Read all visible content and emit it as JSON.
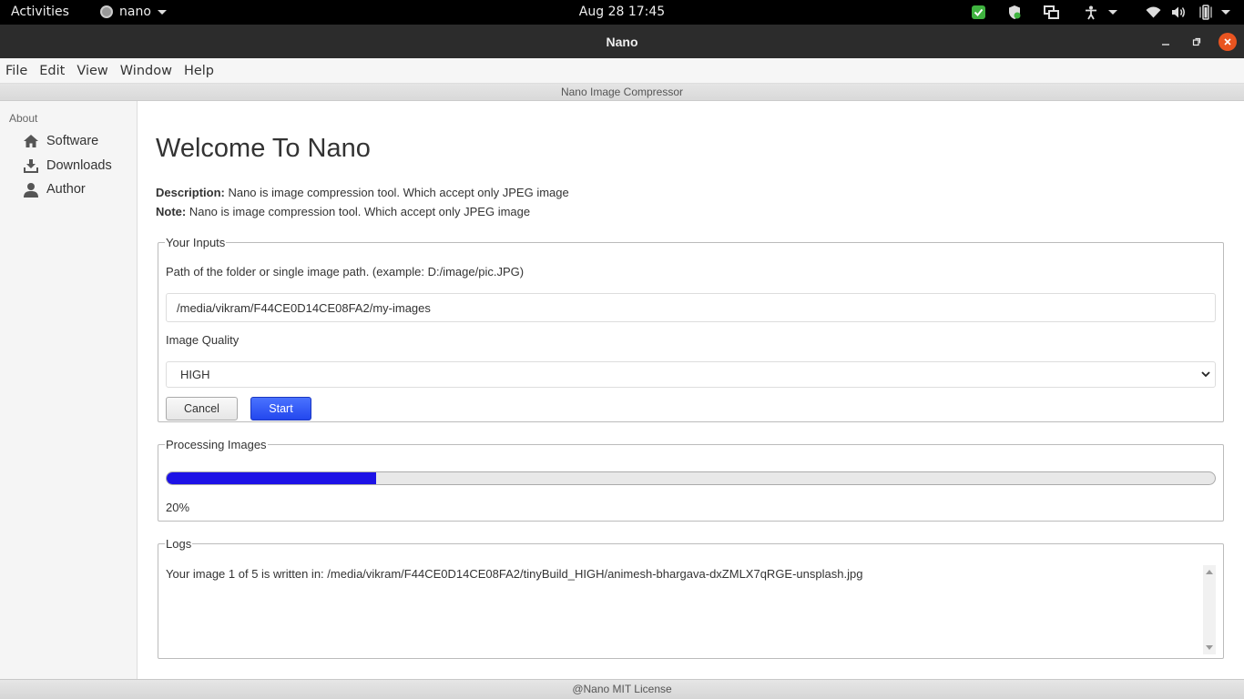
{
  "system_bar": {
    "activities_label": "Activities",
    "app_name": "nano",
    "clock": "Aug 28  17:45"
  },
  "window": {
    "title": "Nano"
  },
  "menu": {
    "items": [
      "File",
      "Edit",
      "View",
      "Window",
      "Help"
    ]
  },
  "app_header": {
    "title": "Nano Image Compressor"
  },
  "sidebar": {
    "heading": "About",
    "items": [
      {
        "label": "Software",
        "icon": "home-icon"
      },
      {
        "label": "Downloads",
        "icon": "download-icon"
      },
      {
        "label": "Author",
        "icon": "person-icon"
      }
    ]
  },
  "main": {
    "title": "Welcome To Nano",
    "description_label": "Description:",
    "description_text": " Nano is image compression tool. Which accept only JPEG image",
    "note_label": "Note:",
    "note_text": " Nano is image compression tool. Which accept only JPEG image"
  },
  "inputs": {
    "legend": "Your Inputs",
    "path_label": "Path of the folder or single image path. (example: D:/image/pic.JPG)",
    "path_value": "/media/vikram/F44CE0D14CE08FA2/my-images",
    "quality_label": "Image Quality",
    "quality_value": "HIGH",
    "cancel_label": "Cancel",
    "start_label": "Start"
  },
  "processing": {
    "legend": "Processing Images",
    "progress_percent": 20,
    "progress_text": "20%"
  },
  "logs": {
    "legend": "Logs",
    "lines": [
      "Your image 1 of 5 is written in: /media/vikram/F44CE0D14CE08FA2/tinyBuild_HIGH/animesh-bhargava-dxZMLX7qRGE-unsplash.jpg"
    ]
  },
  "footer": {
    "text": "@Nano MIT License"
  },
  "colors": {
    "accent": "#2347ee",
    "progress": "#1d12e6",
    "close_button": "#e95420",
    "titlebar": "#2c2c2c"
  }
}
